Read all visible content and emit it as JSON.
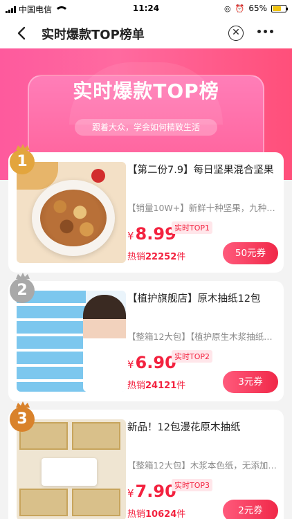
{
  "status_bar": {
    "carrier": "中国电信",
    "time": "11:24",
    "battery_percent": "65%",
    "battery_level": 0.65
  },
  "nav": {
    "title": "实时爆款TOP榜单",
    "back_icon": "chevron-left-icon",
    "close_icon": "close-circle-icon",
    "more_icon": "more-dots-icon"
  },
  "banner": {
    "title": "实时爆款TOP榜",
    "subtitle": "跟着大众，学会如何精致生活"
  },
  "colors": {
    "accent": "#f3223f",
    "banner_pink": "#fe5a9d",
    "rank_gold": "#e3a53d",
    "rank_silver": "#a9a9a9",
    "rank_bronze": "#d9822b"
  },
  "products": [
    {
      "rank": "1",
      "title": "【第二份7.9】每日坚果混合坚果",
      "desc": "【销量10W+】新鲜十种坚果，九种…",
      "price_symbol": "¥",
      "price": "8.99",
      "rank_tag": "实时TOP1",
      "sold_prefix": "热销",
      "sold_count": "22252",
      "sold_suffix": "件",
      "coupon": "50元券"
    },
    {
      "rank": "2",
      "title": "【植护旗舰店】原木抽纸12包",
      "desc": "【整箱12大包】【植护原生木浆抽纸…",
      "price_symbol": "¥",
      "price": "6.90",
      "rank_tag": "实时TOP2",
      "sold_prefix": "热销",
      "sold_count": "24121",
      "sold_suffix": "件",
      "coupon": "3元券"
    },
    {
      "rank": "3",
      "title": "新品！12包漫花原木抽纸",
      "desc": "【整箱12大包】木浆本色纸，无添加…",
      "price_symbol": "¥",
      "price": "7.90",
      "rank_tag": "实时TOP3",
      "sold_prefix": "热销",
      "sold_count": "10624",
      "sold_suffix": "件",
      "coupon": "2元券"
    }
  ]
}
